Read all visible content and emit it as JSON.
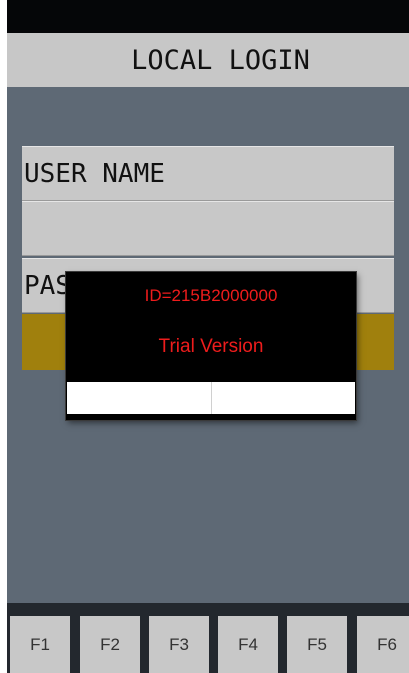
{
  "header": {
    "title": "LOCAL LOGIN"
  },
  "form": {
    "username_label": "USER NAME",
    "username_value": "",
    "password_label": "PAS"
  },
  "dialog": {
    "id_text": "ID=215B2000000",
    "message": "Trial Version",
    "buttons": [
      "",
      ""
    ]
  },
  "function_keys": [
    "F1",
    "F2",
    "F3",
    "F4",
    "F5",
    "F6"
  ],
  "colors": {
    "background": "#5e6975",
    "panel": "#c8c8c8",
    "accent_bar": "#a0800d",
    "dialog_text": "#ee1c1c"
  }
}
